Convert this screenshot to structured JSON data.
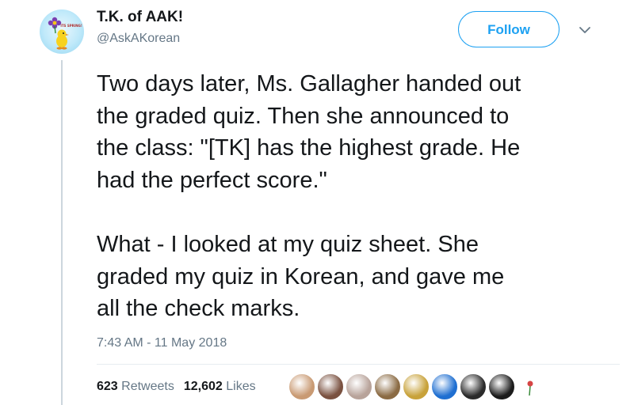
{
  "author": {
    "display_name": "T.K. of AAK!",
    "handle": "@AskAKorean",
    "avatar_text": "ITS SPRING!"
  },
  "follow_label": "Follow",
  "tweet": {
    "paragraphs": [
      "Two days later, Ms. Gallagher handed out\nthe graded quiz. Then she announced to\nthe class: \"[TK] has the highest grade. He\nhad the perfect score.\"",
      "What - I looked at my quiz sheet. She\ngraded my quiz in Korean, and gave me\nall the check marks."
    ],
    "timestamp": "7:43 AM - 11 May 2018"
  },
  "stats": {
    "retweets_count": "623",
    "retweets_label": "Retweets",
    "likes_count": "12,602",
    "likes_label": "Likes"
  },
  "likers": [
    {
      "name": "liker-avatar-1",
      "color": "#c99a73"
    },
    {
      "name": "liker-avatar-2",
      "color": "#7a5140"
    },
    {
      "name": "liker-avatar-3",
      "color": "#b8a39a"
    },
    {
      "name": "liker-avatar-4",
      "color": "#8b6b44"
    },
    {
      "name": "liker-avatar-5",
      "color": "#c8a23a"
    },
    {
      "name": "liker-avatar-6",
      "color": "#1f6fd1"
    },
    {
      "name": "liker-avatar-7",
      "color": "#2b2b2b"
    },
    {
      "name": "liker-avatar-8",
      "color": "#1b1b1b"
    },
    {
      "name": "liker-avatar-9",
      "color": "#d64545"
    }
  ],
  "colors": {
    "accent": "#1da1f2",
    "text": "#14171a",
    "secondary_text": "#657786"
  },
  "icons": {
    "caret": "chevron-down-icon"
  }
}
